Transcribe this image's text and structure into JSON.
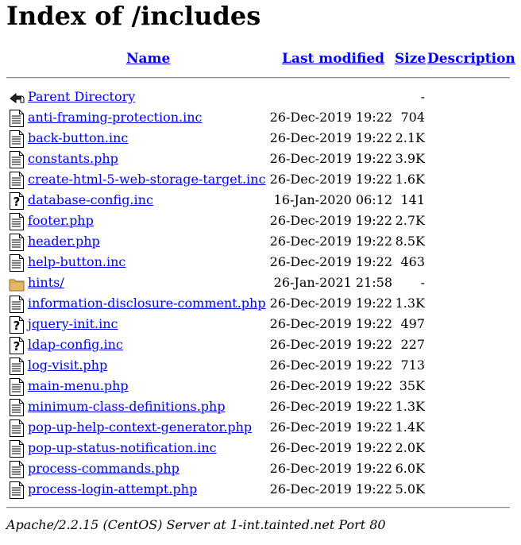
{
  "page": {
    "title": "Index of /includes"
  },
  "columns": {
    "name": "Name",
    "last_modified": "Last modified",
    "size": "Size",
    "description": "Description"
  },
  "entries": [
    {
      "name": "Parent Directory",
      "date": "",
      "size": "-",
      "icon": "back-icon"
    },
    {
      "name": "anti-framing-protection.inc",
      "date": "26-Dec-2019 19:22",
      "size": "704",
      "icon": "text-file-icon"
    },
    {
      "name": "back-button.inc",
      "date": "26-Dec-2019 19:22",
      "size": "2.1K",
      "icon": "text-file-icon"
    },
    {
      "name": "constants.php",
      "date": "26-Dec-2019 19:22",
      "size": "3.9K",
      "icon": "text-file-icon"
    },
    {
      "name": "create-html-5-web-storage-target.inc",
      "date": "26-Dec-2019 19:22",
      "size": "1.6K",
      "icon": "text-file-icon"
    },
    {
      "name": "database-config.inc",
      "date": "16-Jan-2020 06:12",
      "size": "141",
      "icon": "unknown-file-icon"
    },
    {
      "name": "footer.php",
      "date": "26-Dec-2019 19:22",
      "size": "2.7K",
      "icon": "text-file-icon"
    },
    {
      "name": "header.php",
      "date": "26-Dec-2019 19:22",
      "size": "8.5K",
      "icon": "text-file-icon"
    },
    {
      "name": "help-button.inc",
      "date": "26-Dec-2019 19:22",
      "size": "463",
      "icon": "text-file-icon"
    },
    {
      "name": "hints/",
      "date": "26-Jan-2021 21:58",
      "size": "-",
      "icon": "folder-icon"
    },
    {
      "name": "information-disclosure-comment.php",
      "date": "26-Dec-2019 19:22",
      "size": "1.3K",
      "icon": "text-file-icon"
    },
    {
      "name": "jquery-init.inc",
      "date": "26-Dec-2019 19:22",
      "size": "497",
      "icon": "unknown-file-icon"
    },
    {
      "name": "ldap-config.inc",
      "date": "26-Dec-2019 19:22",
      "size": "227",
      "icon": "unknown-file-icon"
    },
    {
      "name": "log-visit.php",
      "date": "26-Dec-2019 19:22",
      "size": "713",
      "icon": "text-file-icon"
    },
    {
      "name": "main-menu.php",
      "date": "26-Dec-2019 19:22",
      "size": "35K",
      "icon": "text-file-icon"
    },
    {
      "name": "minimum-class-definitions.php",
      "date": "26-Dec-2019 19:22",
      "size": "1.3K",
      "icon": "text-file-icon"
    },
    {
      "name": "pop-up-help-context-generator.php",
      "date": "26-Dec-2019 19:22",
      "size": "1.4K",
      "icon": "text-file-icon"
    },
    {
      "name": "pop-up-status-notification.inc",
      "date": "26-Dec-2019 19:22",
      "size": "2.0K",
      "icon": "text-file-icon"
    },
    {
      "name": "process-commands.php",
      "date": "26-Dec-2019 19:22",
      "size": "6.0K",
      "icon": "text-file-icon"
    },
    {
      "name": "process-login-attempt.php",
      "date": "26-Dec-2019 19:22",
      "size": "5.0K",
      "icon": "text-file-icon"
    }
  ],
  "footer": {
    "text": "Apache/2.2.15 (CentOS) Server at 1-int.tainted.net Port 80"
  },
  "colors": {
    "link": "#0000ee",
    "folder": "#e8b765"
  }
}
